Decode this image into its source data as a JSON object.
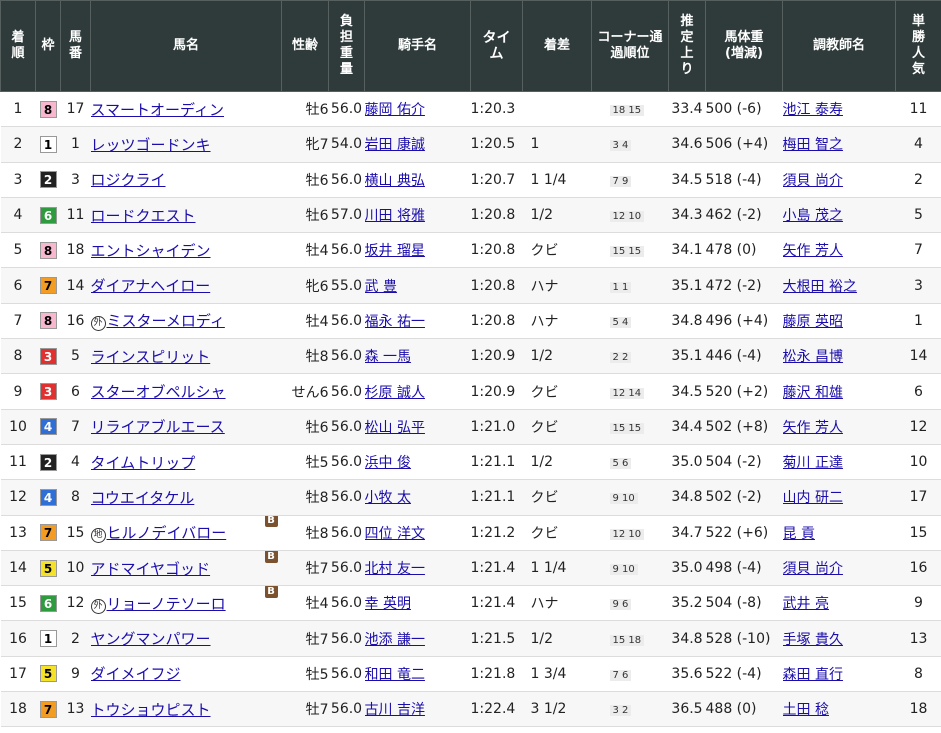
{
  "headers": {
    "finish": "着順",
    "waku": "枠",
    "umaban": "馬番",
    "horse": "馬名",
    "sexage": "性齢",
    "weight": "負担重量",
    "jockey": "騎手名",
    "time": "タイム",
    "margin": "着差",
    "corner": "コーナー通過順位",
    "last3f": "推定上り",
    "body": "馬体重(増減)",
    "trainer": "調教師名",
    "pop": "単勝人気"
  },
  "waku_colors": {
    "1": {
      "bg": "#ffffff",
      "fg": "#000000"
    },
    "2": {
      "bg": "#222222",
      "fg": "#ffffff"
    },
    "3": {
      "bg": "#e03030",
      "fg": "#ffffff"
    },
    "4": {
      "bg": "#2f6fd6",
      "fg": "#ffffff"
    },
    "5": {
      "bg": "#f4e12a",
      "fg": "#000000"
    },
    "6": {
      "bg": "#2e9b3e",
      "fg": "#ffffff"
    },
    "7": {
      "bg": "#f39c23",
      "fg": "#000000"
    },
    "8": {
      "bg": "#f7b8cf",
      "fg": "#000000"
    }
  },
  "rows": [
    {
      "finish": "1",
      "waku": "8",
      "umaban": "17",
      "prefix": "",
      "horse": "スマートオーディン",
      "blinker": false,
      "sexage": "牡6",
      "weight": "56.0",
      "jockey": "藤岡 佑介",
      "time": "1:20.3",
      "margin": "",
      "corner": "18 15",
      "last3f": "33.4",
      "body": "500 (-6)",
      "trainer": "池江 泰寿",
      "pop": "11"
    },
    {
      "finish": "2",
      "waku": "1",
      "umaban": "1",
      "prefix": "",
      "horse": "レッツゴードンキ",
      "blinker": false,
      "sexage": "牝7",
      "weight": "54.0",
      "jockey": "岩田 康誠",
      "time": "1:20.5",
      "margin": "1",
      "corner": "3 4",
      "last3f": "34.6",
      "body": "506 (+4)",
      "trainer": "梅田 智之",
      "pop": "4"
    },
    {
      "finish": "3",
      "waku": "2",
      "umaban": "3",
      "prefix": "",
      "horse": "ロジクライ",
      "blinker": false,
      "sexage": "牡6",
      "weight": "56.0",
      "jockey": "横山 典弘",
      "time": "1:20.7",
      "margin": "1 1/4",
      "corner": "7 9",
      "last3f": "34.5",
      "body": "518 (-4)",
      "trainer": "須貝 尚介",
      "pop": "2"
    },
    {
      "finish": "4",
      "waku": "6",
      "umaban": "11",
      "prefix": "",
      "horse": "ロードクエスト",
      "blinker": false,
      "sexage": "牡6",
      "weight": "57.0",
      "jockey": "川田 将雅",
      "time": "1:20.8",
      "margin": "1/2",
      "corner": "12 10",
      "last3f": "34.3",
      "body": "462 (-2)",
      "trainer": "小島 茂之",
      "pop": "5"
    },
    {
      "finish": "5",
      "waku": "8",
      "umaban": "18",
      "prefix": "",
      "horse": "エントシャイデン",
      "blinker": false,
      "sexage": "牡4",
      "weight": "56.0",
      "jockey": "坂井 瑠星",
      "time": "1:20.8",
      "margin": "クビ",
      "corner": "15 15",
      "last3f": "34.1",
      "body": "478 (0)",
      "trainer": "矢作 芳人",
      "pop": "7"
    },
    {
      "finish": "6",
      "waku": "7",
      "umaban": "14",
      "prefix": "",
      "horse": "ダイアナヘイロー",
      "blinker": false,
      "sexage": "牝6",
      "weight": "55.0",
      "jockey": "武 豊",
      "time": "1:20.8",
      "margin": "ハナ",
      "corner": "1 1",
      "last3f": "35.1",
      "body": "472 (-2)",
      "trainer": "大根田 裕之",
      "pop": "3"
    },
    {
      "finish": "7",
      "waku": "8",
      "umaban": "16",
      "prefix": "外",
      "horse": "ミスターメロディ",
      "blinker": false,
      "sexage": "牡4",
      "weight": "56.0",
      "jockey": "福永 祐一",
      "time": "1:20.8",
      "margin": "ハナ",
      "corner": "5 4",
      "last3f": "34.8",
      "body": "496 (+4)",
      "trainer": "藤原 英昭",
      "pop": "1"
    },
    {
      "finish": "8",
      "waku": "3",
      "umaban": "5",
      "prefix": "",
      "horse": "ラインスピリット",
      "blinker": false,
      "sexage": "牡8",
      "weight": "56.0",
      "jockey": "森 一馬",
      "time": "1:20.9",
      "margin": "1/2",
      "corner": "2 2",
      "last3f": "35.1",
      "body": "446 (-4)",
      "trainer": "松永 昌博",
      "pop": "14"
    },
    {
      "finish": "9",
      "waku": "3",
      "umaban": "6",
      "prefix": "",
      "horse": "スターオブペルシャ",
      "blinker": false,
      "sexage": "せん6",
      "weight": "56.0",
      "jockey": "杉原 誠人",
      "time": "1:20.9",
      "margin": "クビ",
      "corner": "12 14",
      "last3f": "34.5",
      "body": "520 (+2)",
      "trainer": "藤沢 和雄",
      "pop": "6"
    },
    {
      "finish": "10",
      "waku": "4",
      "umaban": "7",
      "prefix": "",
      "horse": "リライアブルエース",
      "blinker": false,
      "sexage": "牡6",
      "weight": "56.0",
      "jockey": "松山 弘平",
      "time": "1:21.0",
      "margin": "クビ",
      "corner": "15 15",
      "last3f": "34.4",
      "body": "502 (+8)",
      "trainer": "矢作 芳人",
      "pop": "12"
    },
    {
      "finish": "11",
      "waku": "2",
      "umaban": "4",
      "prefix": "",
      "horse": "タイムトリップ",
      "blinker": false,
      "sexage": "牡5",
      "weight": "56.0",
      "jockey": "浜中 俊",
      "time": "1:21.1",
      "margin": "1/2",
      "corner": "5 6",
      "last3f": "35.0",
      "body": "504 (-2)",
      "trainer": "菊川 正達",
      "pop": "10"
    },
    {
      "finish": "12",
      "waku": "4",
      "umaban": "8",
      "prefix": "",
      "horse": "コウエイタケル",
      "blinker": false,
      "sexage": "牡8",
      "weight": "56.0",
      "jockey": "小牧 太",
      "time": "1:21.1",
      "margin": "クビ",
      "corner": "9 10",
      "last3f": "34.8",
      "body": "502 (-2)",
      "trainer": "山内 研二",
      "pop": "17"
    },
    {
      "finish": "13",
      "waku": "7",
      "umaban": "15",
      "prefix": "地",
      "horse": "ヒルノデイバロー",
      "blinker": true,
      "sexage": "牡8",
      "weight": "56.0",
      "jockey": "四位 洋文",
      "time": "1:21.2",
      "margin": "クビ",
      "corner": "12 10",
      "last3f": "34.7",
      "body": "522 (+6)",
      "trainer": "昆 貢",
      "pop": "15"
    },
    {
      "finish": "14",
      "waku": "5",
      "umaban": "10",
      "prefix": "",
      "horse": "アドマイヤゴッド",
      "blinker": true,
      "sexage": "牡7",
      "weight": "56.0",
      "jockey": "北村 友一",
      "time": "1:21.4",
      "margin": "1 1/4",
      "corner": "9 10",
      "last3f": "35.0",
      "body": "498 (-4)",
      "trainer": "須貝 尚介",
      "pop": "16"
    },
    {
      "finish": "15",
      "waku": "6",
      "umaban": "12",
      "prefix": "外",
      "horse": "リョーノテソーロ",
      "blinker": true,
      "sexage": "牡4",
      "weight": "56.0",
      "jockey": "幸 英明",
      "time": "1:21.4",
      "margin": "ハナ",
      "corner": "9 6",
      "last3f": "35.2",
      "body": "504 (-8)",
      "trainer": "武井 亮",
      "pop": "9"
    },
    {
      "finish": "16",
      "waku": "1",
      "umaban": "2",
      "prefix": "",
      "horse": "ヤングマンパワー",
      "blinker": false,
      "sexage": "牡7",
      "weight": "56.0",
      "jockey": "池添 謙一",
      "time": "1:21.5",
      "margin": "1/2",
      "corner": "15 18",
      "last3f": "34.8",
      "body": "528 (-10)",
      "trainer": "手塚 貴久",
      "pop": "13"
    },
    {
      "finish": "17",
      "waku": "5",
      "umaban": "9",
      "prefix": "",
      "horse": "ダイメイフジ",
      "blinker": false,
      "sexage": "牡5",
      "weight": "56.0",
      "jockey": "和田 竜二",
      "time": "1:21.8",
      "margin": "1 3/4",
      "corner": "7 6",
      "last3f": "35.6",
      "body": "522 (-4)",
      "trainer": "森田 直行",
      "pop": "8"
    },
    {
      "finish": "18",
      "waku": "7",
      "umaban": "13",
      "prefix": "",
      "horse": "トウショウピスト",
      "blinker": false,
      "sexage": "牡7",
      "weight": "56.0",
      "jockey": "古川 吉洋",
      "time": "1:22.4",
      "margin": "3 1/2",
      "corner": "3 2",
      "last3f": "36.5",
      "body": "488 (0)",
      "trainer": "土田 稔",
      "pop": "18"
    }
  ],
  "blinker_label": "B"
}
